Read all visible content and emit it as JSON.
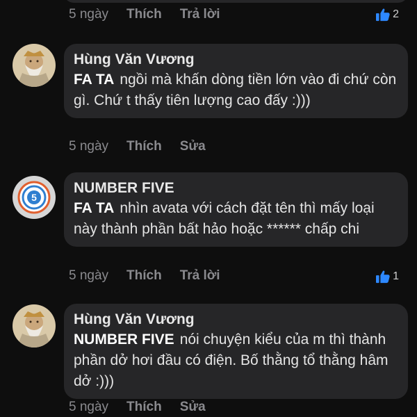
{
  "colors": {
    "background": "#0e0e0e",
    "bubble": "#262628",
    "meta_text": "#8a8a8e",
    "like_blue": "#2d88ff"
  },
  "top_actions": {
    "time": "5 ngày",
    "like": "Thích",
    "reply": "Trả lời",
    "like_count": "2",
    "like_icon": "thumbs-up-icon"
  },
  "comments": [
    {
      "author": "Hùng Văn Vương",
      "mention": "FA TA",
      "text": "ngồi mà khấn dòng tiền lớn vào đi chứ còn gì. Chứ t thấy tiên lượng cao đấy :)))",
      "time": "5 ngày",
      "like": "Thích",
      "action": "Sửa",
      "avatar": "old-man-avatar"
    },
    {
      "author": "NUMBER FIVE",
      "mention": "FA TA",
      "text": "nhìn avata với cách đặt tên thì mấy loại này thành phần bất hảo hoặc ****** chấp chi",
      "time": "5 ngày",
      "like": "Thích",
      "action": "Trả lời",
      "like_count": "1",
      "like_icon": "thumbs-up-icon",
      "avatar": "number-five-logo-avatar"
    },
    {
      "author": "Hùng Văn Vương",
      "mention": "NUMBER FIVE",
      "text": "nói chuyện kiểu của m thì thành phần dở hơi đầu có điện. Bố thằng tổ thằng hâm dở :)))",
      "time": "5 ngày",
      "like": "Thích",
      "action": "Sửa",
      "avatar": "old-man-avatar"
    }
  ]
}
